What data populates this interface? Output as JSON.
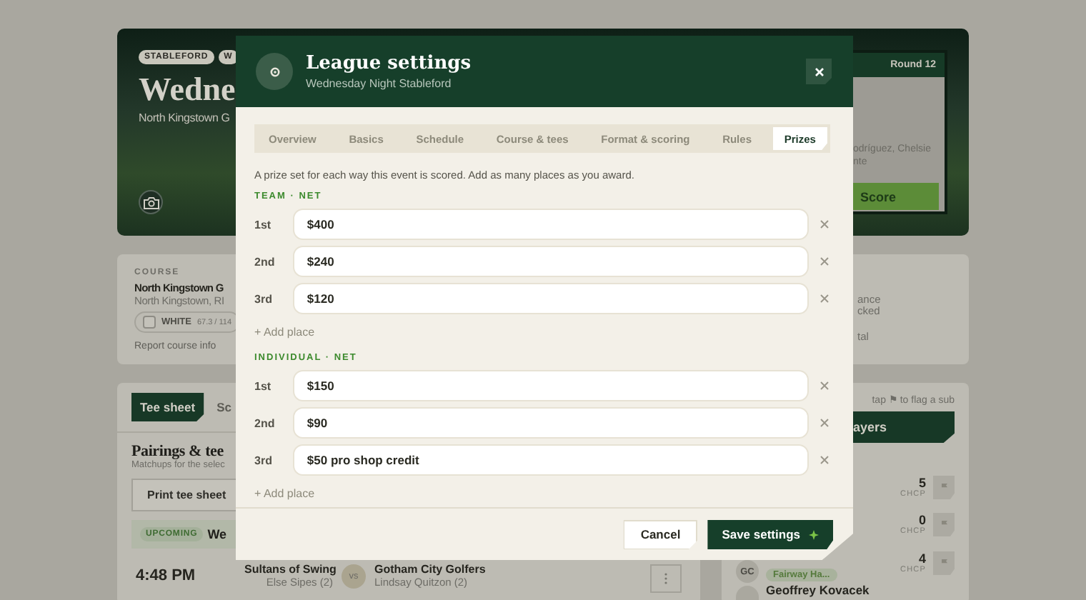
{
  "background": {
    "hero": {
      "badges": [
        "STABLEFORD",
        "W"
      ],
      "title": "Wedne",
      "subtitle": "North Kingstown G",
      "round": "Round 12",
      "players_lines": [
        "odríguez, Chelsie",
        "nte"
      ],
      "score_button": "Score"
    },
    "course": {
      "eyebrow": "COURSE",
      "name": "North Kingstown G",
      "location": "North Kingstown, RI",
      "tee": {
        "name": "WHITE",
        "rating": "67.3 / 114"
      },
      "link": "Report course info"
    },
    "course_side": {
      "lines": [
        "ance",
        "cked",
        "tal"
      ]
    },
    "tee_sheet": {
      "tabs": [
        {
          "label": "Tee sheet",
          "selected": true
        },
        {
          "label": "Sc",
          "selected": false
        }
      ],
      "title": "Pairings & tee",
      "subtitle": "Matchups for the selec",
      "print_button": "Print tee sheet",
      "status_badge": "UPCOMING",
      "status_text": "We",
      "match": {
        "time": "4:48 PM",
        "team_a": "Sultans of Swing",
        "team_a_player": "Else Sipes (2)",
        "vs": "vs",
        "team_b": "Gotham City Golfers",
        "team_b_player": "Lindsay Quitzon (2)"
      }
    },
    "players": {
      "hint": "tap ⚑ to flag a sub",
      "button": "ayers",
      "rows": [
        {
          "chcp": "5",
          "chcp_label": "CHCP"
        },
        {
          "chcp": "0",
          "chcp_label": "CHCP"
        },
        {
          "initials": "GC",
          "tag": "Fairway Ha...",
          "chcp": "4",
          "chcp_label": "CHCP"
        },
        {
          "name": "Geoffrey Kovacek"
        }
      ]
    }
  },
  "modal": {
    "title": "League settings",
    "subtitle": "Wednesday Night Stableford",
    "tabs": [
      {
        "label": "Overview",
        "selected": false
      },
      {
        "label": "Basics",
        "selected": false
      },
      {
        "label": "Schedule",
        "selected": false
      },
      {
        "label": "Course & tees",
        "selected": false
      },
      {
        "label": "Format & scoring",
        "selected": false
      },
      {
        "label": "Rules",
        "selected": false
      },
      {
        "label": "Prizes",
        "selected": true
      }
    ],
    "intro": "A prize set for each way this event is scored. Add as many places as you award.",
    "prize_sets": [
      {
        "title": "TEAM · NET",
        "places": [
          {
            "label": "1st",
            "value": "$400"
          },
          {
            "label": "2nd",
            "value": "$240"
          },
          {
            "label": "3rd",
            "value": "$120"
          }
        ],
        "add_label": "+ Add place"
      },
      {
        "title": "INDIVIDUAL · NET",
        "places": [
          {
            "label": "1st",
            "value": "$150"
          },
          {
            "label": "2nd",
            "value": "$90"
          },
          {
            "label": "3rd",
            "value": "$50 pro shop credit"
          }
        ],
        "add_label": "+ Add place"
      }
    ],
    "cancel": "Cancel",
    "save": "Save settings"
  }
}
